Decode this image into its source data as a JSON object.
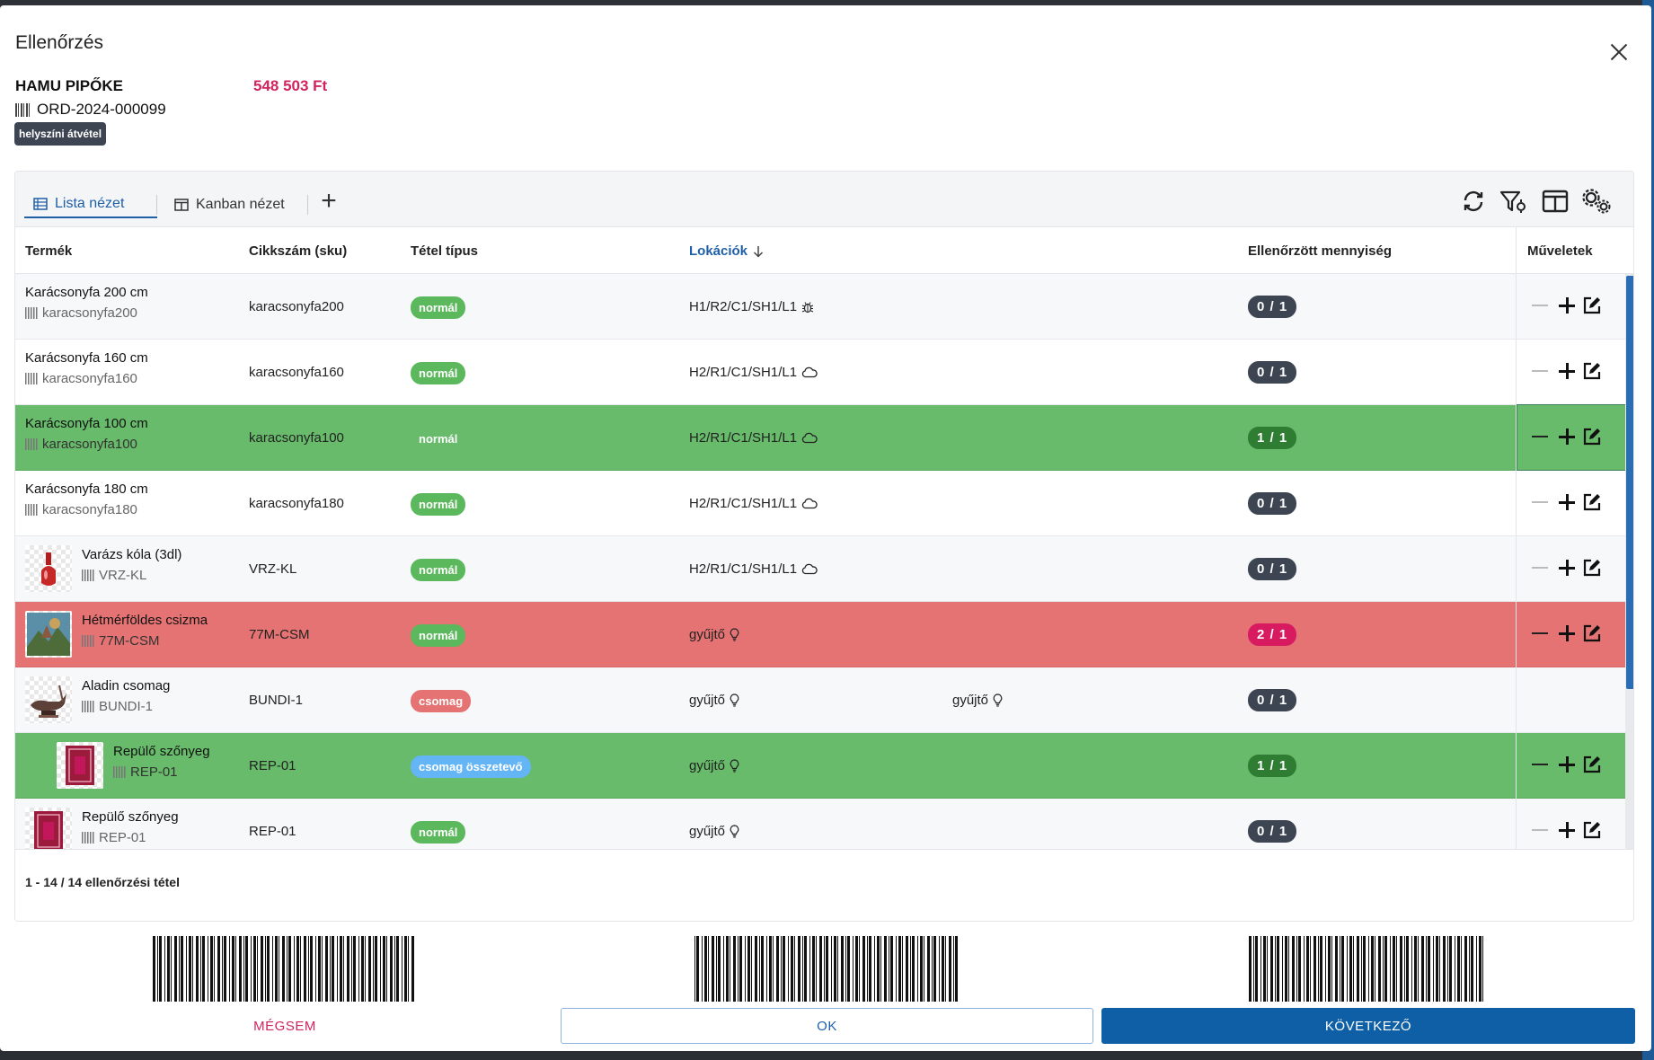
{
  "dialog": {
    "title": "Ellenőrzés",
    "customer_name": "HAMU PIPŐKE",
    "total": "548 503 Ft",
    "order_id": "ORD-2024-000099",
    "delivery_badge": "helyszíni átvétel"
  },
  "toolbar": {
    "tabs": [
      {
        "label": "Lista nézet",
        "active": true
      },
      {
        "label": "Kanban nézet",
        "active": false
      }
    ],
    "add_tab_label": "+",
    "icons": [
      "refresh-icon",
      "filter-settings-icon",
      "columns-icon",
      "settings-icon"
    ]
  },
  "table": {
    "headers": {
      "product": "Termék",
      "sku": "Cikkszám (sku)",
      "type": "Tétel típus",
      "location": "Lokációk",
      "checked_qty": "Ellenőrzött mennyiség",
      "actions": "Műveletek"
    },
    "rows": [
      {
        "name": "Karácsonyfa 200 cm",
        "barcode": "karacsonyfa200",
        "sku": "karacsonyfa200",
        "type": "normál",
        "type_kind": "normal",
        "loc": "H1/R2/C1/SH1/L1",
        "loc_icon": "bug-icon",
        "loc2": "",
        "qty": "0 / 1",
        "status": "pending",
        "thumb": ""
      },
      {
        "name": "Karácsonyfa 160 cm",
        "barcode": "karacsonyfa160",
        "sku": "karacsonyfa160",
        "type": "normál",
        "type_kind": "normal",
        "loc": "H2/R1/C1/SH1/L1",
        "loc_icon": "cloud-icon",
        "loc2": "",
        "qty": "0 / 1",
        "status": "pending",
        "thumb": ""
      },
      {
        "name": "Karácsonyfa 100 cm",
        "barcode": "karacsonyfa100",
        "sku": "karacsonyfa100",
        "type": "normál",
        "type_kind": "normal",
        "loc": "H2/R1/C1/SH1/L1",
        "loc_icon": "cloud-icon",
        "loc2": "",
        "qty": "1 / 1",
        "status": "done",
        "thumb": ""
      },
      {
        "name": "Karácsonyfa 180 cm",
        "barcode": "karacsonyfa180",
        "sku": "karacsonyfa180",
        "type": "normál",
        "type_kind": "normal",
        "loc": "H2/R1/C1/SH1/L1",
        "loc_icon": "cloud-icon",
        "loc2": "",
        "qty": "0 / 1",
        "status": "pending",
        "thumb": ""
      },
      {
        "name": "Varázs kóla (3dl)",
        "barcode": "VRZ-KL",
        "sku": "VRZ-KL",
        "type": "normál",
        "type_kind": "normal",
        "loc": "H2/R1/C1/SH1/L1",
        "loc_icon": "cloud-icon",
        "loc2": "",
        "qty": "0 / 1",
        "status": "pending",
        "thumb": "bottle"
      },
      {
        "name": "Hétmérföldes csizma",
        "barcode": "77M-CSM",
        "sku": "77M-CSM",
        "type": "normál",
        "type_kind": "normal",
        "loc": "gyűjtő",
        "loc_icon": "lightbulb-icon",
        "loc2": "",
        "qty": "2 / 1",
        "status": "over",
        "thumb": "painting"
      },
      {
        "name": "Aladin csomag",
        "barcode": "BUNDI-1",
        "sku": "BUNDI-1",
        "type": "csomag",
        "type_kind": "package",
        "loc": "gyűjtő",
        "loc_icon": "lightbulb-icon",
        "loc2": "gyűjtő",
        "qty": "0 / 1",
        "status": "package",
        "thumb": "lamp"
      },
      {
        "name": "Repülő szőnyeg",
        "barcode": "REP-01",
        "sku": "REP-01",
        "type": "csomag összetevő",
        "type_kind": "component",
        "loc": "gyűjtő",
        "loc_icon": "lightbulb-icon",
        "loc2": "",
        "qty": "1 / 1",
        "status": "done",
        "thumb": "carpet"
      },
      {
        "name": "Repülő szőnyeg",
        "barcode": "REP-01",
        "sku": "REP-01",
        "type": "normál",
        "type_kind": "normal",
        "loc": "gyűjtő",
        "loc_icon": "lightbulb-icon",
        "loc2": "",
        "qty": "0 / 1",
        "status": "pending",
        "thumb": "carpet"
      }
    ],
    "footer": "1 - 14 / 14 ellenőrzési tétel"
  },
  "actions": {
    "cancel": "MÉGSEM",
    "ok": "OK",
    "next": "KÖVETKEZŐ"
  },
  "colors": {
    "accent": "#1e5fa8",
    "done_row": "#67bb6a",
    "over_row": "#e57373",
    "price": "#d0245e"
  }
}
